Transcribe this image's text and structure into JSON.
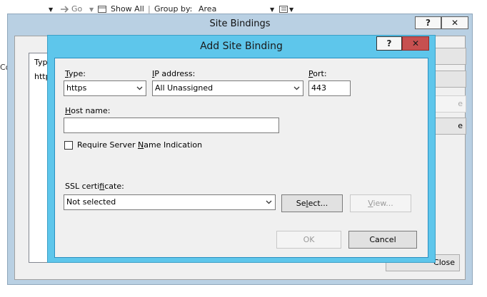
{
  "toolbar": {
    "go_label": "Go",
    "show_all_label": "Show All",
    "group_by_label": "Group by:",
    "group_by_value": "Area"
  },
  "site_bindings": {
    "title": "Site Bindings",
    "help_glyph": "?",
    "close_glyph": "✕",
    "list_header_type": "Type",
    "list_row_type": "http",
    "close_button_label": "Close"
  },
  "dialog": {
    "title": "Add Site Binding",
    "help_glyph": "?",
    "close_glyph": "✕",
    "type": {
      "label_mnemonic": "T",
      "label_rest": "ype:",
      "value": "https"
    },
    "ip_address": {
      "label_mnemonic": "I",
      "label_rest": "P address:",
      "value": "All Unassigned"
    },
    "port": {
      "label_mnemonic": "P",
      "label_rest": "ort:",
      "value": "443"
    },
    "host_name": {
      "label_mnemonic": "H",
      "label_rest": "ost name:",
      "value": ""
    },
    "sni": {
      "label_before": "Require Server ",
      "label_mnemonic": "N",
      "label_after": "ame Indication",
      "checked": false
    },
    "ssl_certificate": {
      "label_before": "SSL certi",
      "label_mnemonic": "f",
      "label_after": "icate:",
      "value": "Not selected"
    },
    "select_button": {
      "label_before": "Se",
      "label_mnemonic": "l",
      "label_after": "ect..."
    },
    "view_button": {
      "label_mnemonic": "V",
      "label_after": "iew..."
    },
    "ok_label": "OK",
    "cancel_label": "Cancel"
  },
  "colors": {
    "dialog_frame": "#5ec6eb",
    "background_frame": "#b9d0e3",
    "close_button_red": "#c75050",
    "dialog_body": "#f0f0f0"
  },
  "icons": [
    "go-icon",
    "show-all-icon",
    "view-mode-icon",
    "help-icon",
    "close-icon",
    "chevron-down-icon"
  ]
}
